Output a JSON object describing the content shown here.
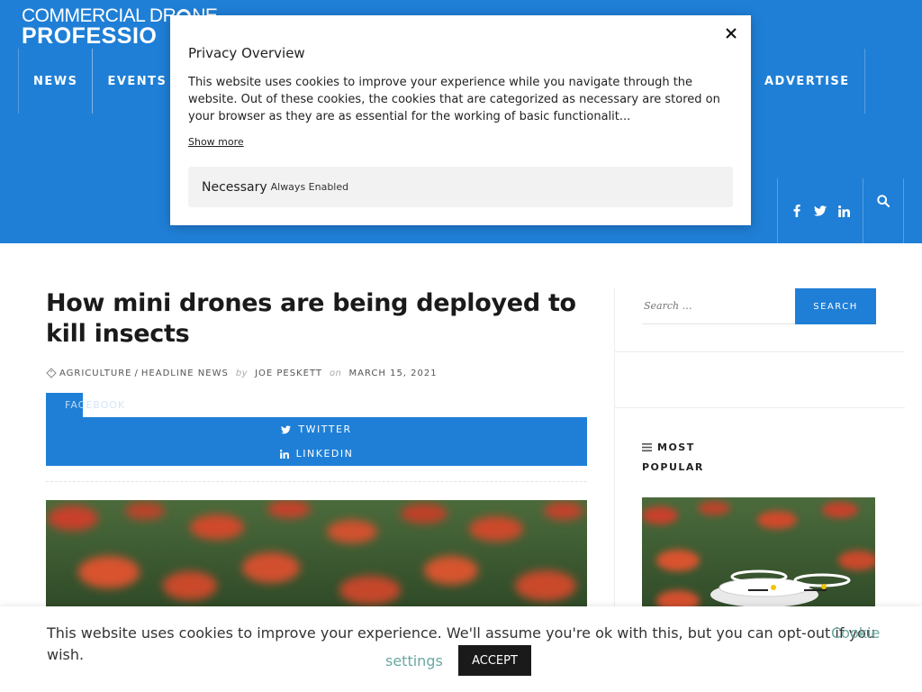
{
  "colors": {
    "brand_blue": "#1f7fd6",
    "cookie_link": "#6aa9a0",
    "accept_bg": "#1a1a1a"
  },
  "logo": {
    "line1": "COMMERCIAL DR",
    "line1_end": "NE",
    "line2": "PROFESSIO"
  },
  "nav": {
    "items": [
      {
        "label": "NEWS"
      },
      {
        "label": "EVENTS"
      }
    ],
    "right_item": "ADVERTISE"
  },
  "social": {
    "icons": [
      "facebook-icon",
      "twitter-icon",
      "linkedin-icon"
    ],
    "search_icon": "search-icon"
  },
  "article": {
    "title": "How mini drones are being deployed to kill insects",
    "categories": [
      "AGRICULTURE",
      "HEADLINE NEWS"
    ],
    "category_separator": "/",
    "by": "by",
    "author": "JOE PESKETT",
    "on": "on",
    "date": "MARCH 15, 2021",
    "share": {
      "facebook": "FACEBOOK",
      "twitter": "TWITTER",
      "linkedin": "LINKEDIN"
    }
  },
  "sidebar": {
    "search_placeholder": "Search …",
    "search_button": "SEARCH",
    "most_popular_title": "MOST POPULAR"
  },
  "privacy_modal": {
    "title": "Privacy Overview",
    "body": "This website uses cookies to improve your experience while you navigate through the website. Out of these cookies, the cookies that are categorized as necessary are stored on your browser as they are as essential for the working of basic functionalit...",
    "show_more": "Show more",
    "necessary_label": "Necessary",
    "necessary_badge": "Always Enabled"
  },
  "cookie_bar": {
    "text": "This website uses cookies to improve your experience. We'll assume you're ok with this, but you can opt-out if you wish.",
    "settings_part1": "Cookie",
    "settings_part2": "settings",
    "accept": "ACCEPT"
  }
}
